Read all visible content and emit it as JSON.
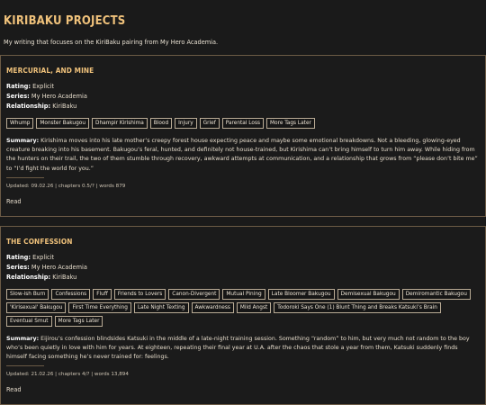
{
  "site": {
    "title": "KIRIBAKU PROJECTS",
    "description": "My writing that focuses on the KiriBaku pairing from My Hero Academia."
  },
  "labels": {
    "rating": "Rating:",
    "series": "Series:",
    "relationship": "Relationship:",
    "summary": "Summary:",
    "read": "Read"
  },
  "works": [
    {
      "title": "MERCURIAL, AND MINE",
      "rating": "Explicit",
      "series": "My Hero Academia",
      "relationship": "KiriBaku",
      "tags": [
        "Whump",
        "Monster Bakugou",
        "Dhampir Kirishima",
        "Blood",
        "Injury",
        "Grief",
        "Parental Loss",
        "More Tags Later"
      ],
      "summary": "Kirishima moves into his late mother’s creepy forest house expecting peace and maybe some emotional breakdowns. Not a bleeding, glowing-eyed creature breaking into his basement. Bakugou’s feral, hunted, and definitely not house-trained, but Kirishima can’t bring himself to turn him away. While hiding from the hunters on their trail, the two of them stumble through recovery, awkward attempts at communication, and a relationship that grows from “please don’t bite me” to “I’d fight the world for you.”",
      "updated": "Updated: 09.02.26 | chapters 0.5/? | words 879"
    },
    {
      "title": "THE CONFESSION",
      "rating": "Explicit",
      "series": "My Hero Academia",
      "relationship": "KiriBaku",
      "tags": [
        "Slow-ish Burn",
        "Confessions",
        "Fluff",
        "Friends to Lovers",
        "Canon-Divergent",
        "Mutual Pining",
        "Late Bloomer Bakugou",
        "Demisexual Bakugou",
        "Demiromantic Bakugou",
        "'Kirisexual' Bakugou",
        "First Time Everything",
        "Late Night Texting",
        "Awkwardness",
        "Mild Angst",
        "Todoroki Says One (1) Blunt Thing and Breaks Katsuki’s Brain",
        "Eventual Smut",
        "More Tags Later"
      ],
      "summary": "Eijirou’s confession blindsides Katsuki in the middle of a late-night training session. Something “random” to him, but very much not random to the boy who’s been quietly in love with him for years. At eighteen, repeating their final year at U.A. after the chaos that stole a year from them, Katsuki suddenly finds himself facing something he’s never trained for: feelings.",
      "updated": "Updated: 21.02.26 | chapters 4/? | words 13,894"
    }
  ]
}
